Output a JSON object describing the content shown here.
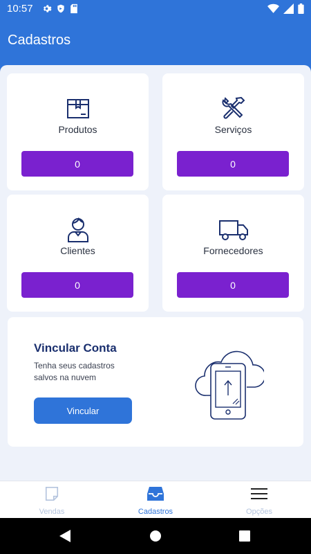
{
  "status_bar": {
    "time": "10:57",
    "icons_left": [
      "gear-icon",
      "shield-icon",
      "sd-card-icon"
    ],
    "icons_right": [
      "wifi-icon",
      "signal-icon",
      "battery-icon"
    ]
  },
  "app_bar": {
    "title": "Cadastros"
  },
  "cards": [
    {
      "label": "Produtos",
      "count": "0",
      "icon": "box-icon"
    },
    {
      "label": "Serviços",
      "count": "0",
      "icon": "tools-icon"
    },
    {
      "label": "Clientes",
      "count": "0",
      "icon": "person-icon"
    },
    {
      "label": "Fornecedores",
      "count": "0",
      "icon": "truck-icon"
    }
  ],
  "link_account": {
    "title": "Vincular Conta",
    "description": "Tenha seus cadastros salvos na nuvem",
    "button_label": "Vincular"
  },
  "bottom_nav": {
    "items": [
      {
        "label": "Vendas",
        "icon": "note-icon",
        "active": false
      },
      {
        "label": "Cadastros",
        "icon": "inbox-icon",
        "active": true
      },
      {
        "label": "Opções",
        "icon": "menu-icon",
        "active": false
      }
    ]
  },
  "colors": {
    "primary": "#2f74d9",
    "accent_purple": "#7a21cf",
    "background": "#eef2fa",
    "icon_navy": "#1a2f6e",
    "nav_inactive": "#b4c4de"
  }
}
